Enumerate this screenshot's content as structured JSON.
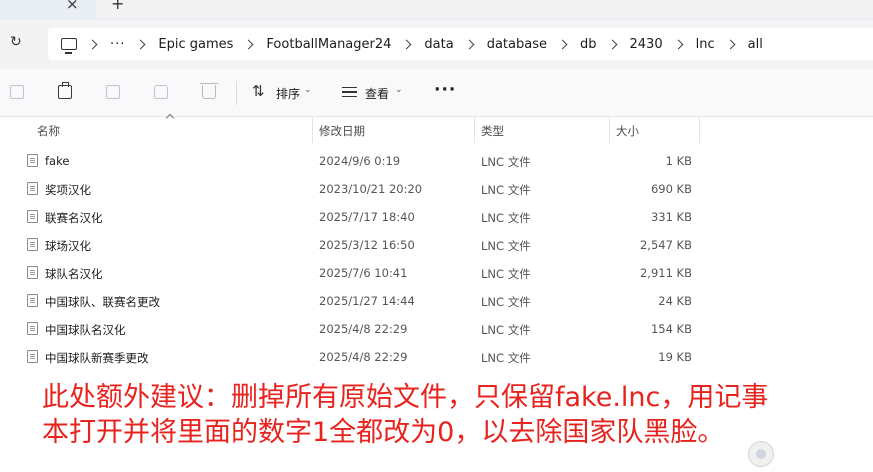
{
  "breadcrumbs": [
    "Epic games",
    "FootballManager24",
    "data",
    "database",
    "db",
    "2430",
    "lnc",
    "all"
  ],
  "breadcrumb_overflow": "···",
  "toolbar": {
    "sort_label": "排序",
    "view_label": "查看",
    "more_label": "···"
  },
  "columns": {
    "name": "名称",
    "date": "修改日期",
    "type": "类型",
    "size": "大小"
  },
  "files": [
    {
      "name": "fake",
      "date": "2024/9/6 0:19",
      "type": "LNC 文件",
      "size": "1 KB"
    },
    {
      "name": "奖项汉化",
      "date": "2023/10/21 20:20",
      "type": "LNC 文件",
      "size": "690 KB"
    },
    {
      "name": "联赛名汉化",
      "date": "2025/7/17 18:40",
      "type": "LNC 文件",
      "size": "331 KB"
    },
    {
      "name": "球场汉化",
      "date": "2025/3/12 16:50",
      "type": "LNC 文件",
      "size": "2,547 KB"
    },
    {
      "name": "球队名汉化",
      "date": "2025/7/6 10:41",
      "type": "LNC 文件",
      "size": "2,911 KB"
    },
    {
      "name": "中国球队、联赛名更改",
      "date": "2025/1/27 14:44",
      "type": "LNC 文件",
      "size": "24 KB"
    },
    {
      "name": "中国球队名汉化",
      "date": "2025/4/8 22:29",
      "type": "LNC 文件",
      "size": "154 KB"
    },
    {
      "name": "中国球队新赛季更改",
      "date": "2025/4/8 22:29",
      "type": "LNC 文件",
      "size": "19 KB"
    }
  ],
  "annotation": {
    "line1": "此处额外建议：删掉所有原始文件，只保留fake.lnc，用记事",
    "line2": "本打开并将里面的数字1全都改为0，以去除国家队黑脸。"
  },
  "colors": {
    "annotation": "#e8231e",
    "toolbar_bg": "#f9f9f9",
    "address_bg": "#f3f3f3"
  }
}
